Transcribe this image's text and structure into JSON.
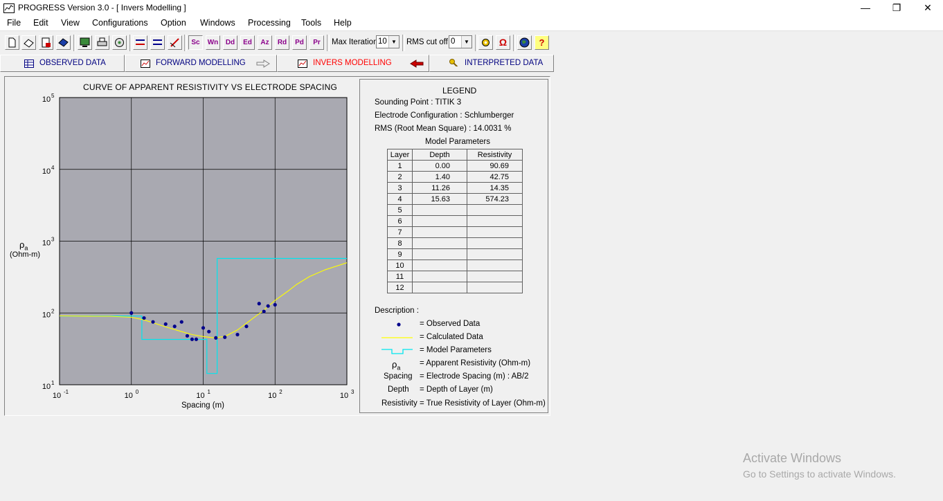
{
  "window": {
    "title": "PROGRESS  Version 3.0 - [ Invers Modelling ]",
    "minimize_glyph": "—",
    "restore_glyph": "❐",
    "close_glyph": "✕"
  },
  "menu": [
    "File",
    "Edit",
    "View",
    "Configurations",
    "Option",
    "Windows",
    "Processing",
    "Tools",
    "Help"
  ],
  "toolbar": {
    "letter_buttons": [
      "Sc",
      "Wn",
      "Dd",
      "Ed",
      "Az",
      "Rd",
      "Pd",
      "Pr"
    ],
    "max_iteration_label": "Max Iteration",
    "max_iteration_value": "10",
    "rms_cutoff_label": "RMS cut off",
    "rms_cutoff_value": "0",
    "help_glyph": "?",
    "omega_glyph": "Ω"
  },
  "tabs": [
    {
      "label": "OBSERVED DATA",
      "icon": "table-icon",
      "active": false
    },
    {
      "label": "FORWARD MODELLING",
      "icon": "chart-icon",
      "active": false
    },
    {
      "label": "INVERS MODELLING",
      "icon": "chart-icon",
      "active": true
    },
    {
      "label": "INTERPRETED DATA",
      "icon": "key-icon",
      "active": false
    }
  ],
  "chart_title": "CURVE OF APPARENT RESISTIVITY VS ELECTRODE SPACING",
  "chart_data": {
    "type": "scatter",
    "title": "CURVE OF APPARENT RESISTIVITY VS ELECTRODE SPACING",
    "xlabel": "Spacing (m)",
    "ylabel": "ρa (Ohm-m)",
    "xscale": "log",
    "yscale": "log",
    "xlim": [
      0.1,
      1000
    ],
    "ylim": [
      10,
      100000
    ],
    "grid": true,
    "x_ticks": [
      "10^-1",
      "10^0",
      "10^1",
      "10^2",
      "10^3"
    ],
    "y_ticks": [
      "10^1",
      "10^2",
      "10^3",
      "10^4",
      "10^5"
    ],
    "series": [
      {
        "name": "Observed Data",
        "type": "scatter",
        "color": "#00008b",
        "x": [
          1.0,
          1.5,
          2.0,
          3.0,
          4.0,
          5.0,
          6.0,
          7.0,
          8.0,
          10.0,
          12.0,
          15.0,
          20.0,
          30.0,
          40.0,
          60.0,
          70.0,
          80.0,
          100.0
        ],
        "y": [
          100,
          85,
          75,
          70,
          65,
          75,
          48,
          43,
          43,
          62,
          55,
          45,
          46,
          50,
          65,
          135,
          105,
          125,
          130
        ]
      },
      {
        "name": "Calculated Data",
        "type": "line",
        "color": "#ffff00",
        "x": [
          0.1,
          0.3,
          0.5,
          1.0,
          1.5,
          2.0,
          3.0,
          5.0,
          7.0,
          10.0,
          14.0,
          20.0,
          30.0,
          50.0,
          70.0,
          100.0,
          150.0,
          200.0,
          300.0,
          500.0,
          1000.0
        ],
        "y": [
          91,
          90,
          90,
          87,
          80,
          73,
          64,
          55,
          50,
          47,
          45,
          47,
          58,
          85,
          110,
          150,
          200,
          250,
          320,
          400,
          500
        ]
      },
      {
        "name": "Model Parameters",
        "type": "step",
        "color": "#00e5ee",
        "x": [
          0.1,
          1.4,
          1.4,
          11.26,
          11.26,
          15.63,
          15.63,
          1000
        ],
        "y": [
          90.69,
          90.69,
          42.75,
          42.75,
          14.35,
          14.35,
          574.23,
          574.23
        ]
      }
    ]
  },
  "legend": {
    "title": "LEGEND",
    "sounding_point": "Sounding Point  :  TITIK 3",
    "electrode_config": "Electrode Configuration  :  Schlumberger",
    "rms": "RMS (Root Mean Square)  :  14.0031 %",
    "model_params_title": "Model  Parameters",
    "table_headers": [
      "Layer",
      "Depth",
      "Resistivity"
    ],
    "table_rows": [
      [
        "1",
        "0.00",
        "90.69"
      ],
      [
        "2",
        "1.40",
        "42.75"
      ],
      [
        "3",
        "11.26",
        "14.35"
      ],
      [
        "4",
        "15.63",
        "574.23"
      ],
      [
        "5",
        "",
        ""
      ],
      [
        "6",
        "",
        ""
      ],
      [
        "7",
        "",
        ""
      ],
      [
        "8",
        "",
        ""
      ],
      [
        "9",
        "",
        ""
      ],
      [
        "10",
        "",
        ""
      ],
      [
        "11",
        "",
        ""
      ],
      [
        "12",
        "",
        ""
      ]
    ],
    "description_label": "Description  :",
    "descriptions": [
      {
        "symbol": "dot",
        "text": "=  Observed Data"
      },
      {
        "symbol": "yellow-line",
        "text": "=  Calculated Data"
      },
      {
        "symbol": "cyan-step",
        "text": "=  Model Parameters"
      },
      {
        "symbol": "ρa",
        "text": "=  Apparent Resistivity (Ohm-m)"
      },
      {
        "symbol": "Spacing",
        "text": "=  Electrode Spacing (m) : AB/2"
      },
      {
        "symbol": "Depth",
        "text": "=  Depth of Layer (m)"
      },
      {
        "symbol": "Resistivity",
        "text": "=  True Resistivity of Layer (Ohm-m)"
      }
    ]
  },
  "watermark": {
    "line1": "Activate Windows",
    "line2": "Go to Settings to activate Windows."
  },
  "colors": {
    "plot_bg": "#a9a9b1",
    "observed": "#00008b",
    "calculated": "#ffff00",
    "model": "#00e5ee",
    "active_tab_text": "#ff0000",
    "tab_text": "#000080"
  }
}
